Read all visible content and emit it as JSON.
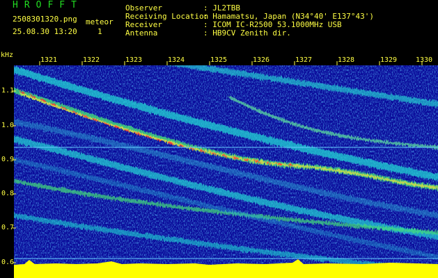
{
  "header": {
    "app_title": "HROFFT",
    "filename": "2508301320.png",
    "datetime": "25.08.30 13:20",
    "count_label": "meteor",
    "count_value": "1",
    "fields": [
      {
        "label": "Observer",
        "value": ": JL2TBB"
      },
      {
        "label": "Receiving Location",
        "value": ": Hamamatsu, Japan (N34°40' E137°43')"
      },
      {
        "label": "Receiver",
        "value": ": ICOM IC-R2500 53.1000MHz USB"
      },
      {
        "label": "Antenna",
        "value": ": HB9CV Zenith dir."
      }
    ]
  },
  "axis": {
    "unit": "kHz",
    "y_ticks": [
      "1.1",
      "1.0",
      "0.9",
      "0.8",
      "0.7",
      "0.6"
    ],
    "x_ticks": [
      "1321",
      "1322",
      "1323",
      "1324",
      "1325",
      "1326",
      "1327",
      "1328",
      "1329",
      "1330"
    ]
  },
  "colors": {
    "background": "#000000",
    "spectrum_bg": "#0a0a9a",
    "header_green": "#22dd22",
    "header_yellow": "#ffff44",
    "noise_floor": "#ffff00",
    "marker_line": "#66ccff"
  }
}
